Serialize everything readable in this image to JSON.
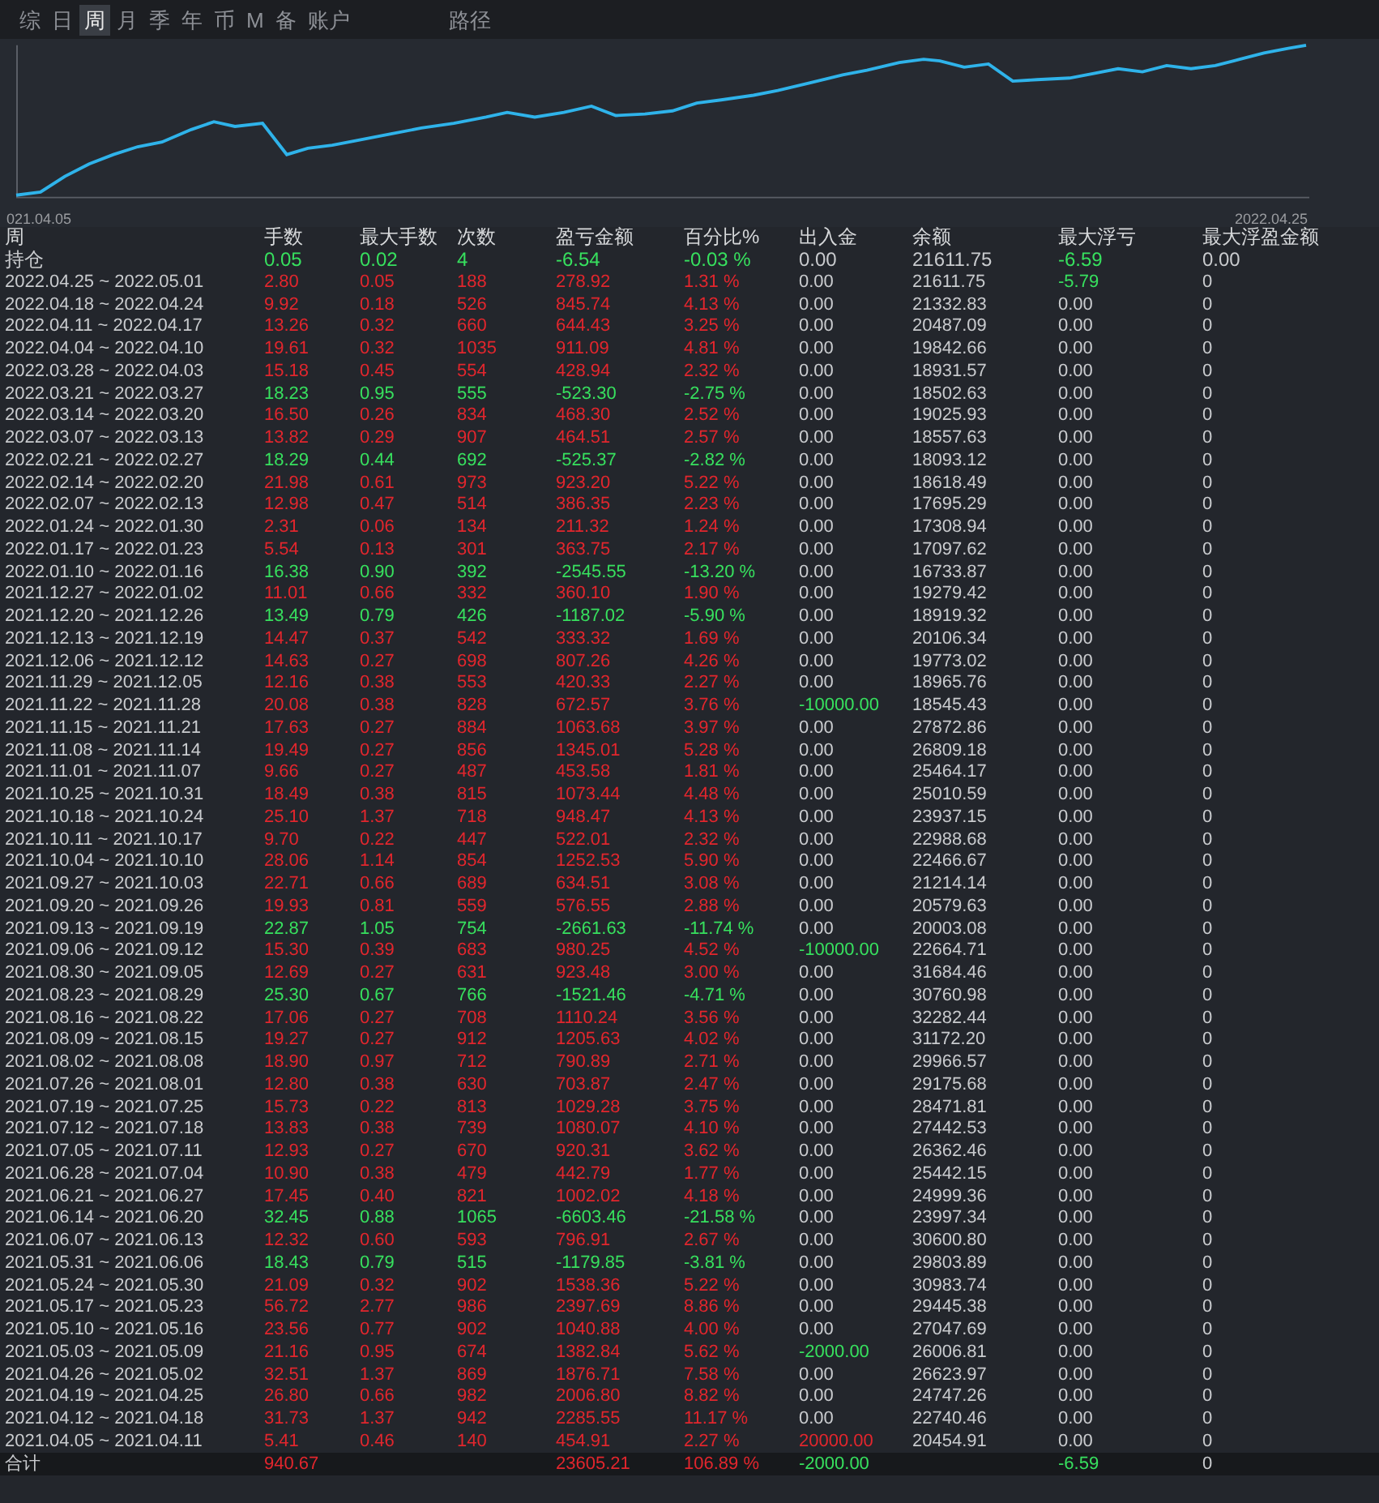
{
  "tabs": [
    {
      "label": "综",
      "selected": false
    },
    {
      "label": "日",
      "selected": false
    },
    {
      "label": "周",
      "selected": true
    },
    {
      "label": "月",
      "selected": false
    },
    {
      "label": "季",
      "selected": false
    },
    {
      "label": "年",
      "selected": false
    },
    {
      "label": "币",
      "selected": false
    },
    {
      "label": "M",
      "selected": false
    },
    {
      "label": "备",
      "selected": false
    },
    {
      "label": "账户",
      "selected": false
    }
  ],
  "path_tab": "路径",
  "chart": {
    "start_label": "021.04.05",
    "end_label": "2022.04.25"
  },
  "columns": [
    "周",
    "手数",
    "最大手数",
    "次数",
    "盈亏金额",
    "百分比%",
    "出入金",
    "余额",
    "最大浮亏",
    "最大浮盈金额"
  ],
  "holding": {
    "period": "持仓",
    "color": "#37e05e",
    "lots": "0.05",
    "max_lots": "0.02",
    "trades": "4",
    "pnl": "-6.54",
    "pct": "-0.03 %",
    "flow": "0.00",
    "balance": "21611.75",
    "max_float_loss": {
      "value": "-6.59",
      "color": "#37e05e"
    },
    "max_float_profit": "0.00"
  },
  "rows": [
    {
      "period": "2022.04.25 ~ 2022.05.01",
      "color": "#e2262d",
      "lots": "2.80",
      "max_lots": "0.05",
      "trades": "188",
      "pnl": "278.92",
      "pct": "1.31 %",
      "flow": "0.00",
      "balance": "21611.75",
      "max_float_loss": {
        "value": "-5.79",
        "color": "#37e05e"
      },
      "max_float_profit": "0"
    },
    {
      "period": "2022.04.18 ~ 2022.04.24",
      "color": "#e2262d",
      "lots": "9.92",
      "max_lots": "0.18",
      "trades": "526",
      "pnl": "845.74",
      "pct": "4.13 %",
      "flow": "0.00",
      "balance": "21332.83",
      "max_float_loss": "0.00",
      "max_float_profit": "0"
    },
    {
      "period": "2022.04.11 ~ 2022.04.17",
      "color": "#e2262d",
      "lots": "13.26",
      "max_lots": "0.32",
      "trades": "660",
      "pnl": "644.43",
      "pct": "3.25 %",
      "flow": "0.00",
      "balance": "20487.09",
      "max_float_loss": "0.00",
      "max_float_profit": "0"
    },
    {
      "period": "2022.04.04 ~ 2022.04.10",
      "color": "#e2262d",
      "lots": "19.61",
      "max_lots": "0.32",
      "trades": "1035",
      "pnl": "911.09",
      "pct": "4.81 %",
      "flow": "0.00",
      "balance": "19842.66",
      "max_float_loss": "0.00",
      "max_float_profit": "0"
    },
    {
      "period": "2022.03.28 ~ 2022.04.03",
      "color": "#e2262d",
      "lots": "15.18",
      "max_lots": "0.45",
      "trades": "554",
      "pnl": "428.94",
      "pct": "2.32 %",
      "flow": "0.00",
      "balance": "18931.57",
      "max_float_loss": "0.00",
      "max_float_profit": "0"
    },
    {
      "period": "2022.03.21 ~ 2022.03.27",
      "color": "#37e05e",
      "lots": "18.23",
      "max_lots": "0.95",
      "trades": "555",
      "pnl": "-523.30",
      "pct": "-2.75 %",
      "flow": "0.00",
      "balance": "18502.63",
      "max_float_loss": "0.00",
      "max_float_profit": "0"
    },
    {
      "period": "2022.03.14 ~ 2022.03.20",
      "color": "#e2262d",
      "lots": "16.50",
      "max_lots": "0.26",
      "trades": "834",
      "pnl": "468.30",
      "pct": "2.52 %",
      "flow": "0.00",
      "balance": "19025.93",
      "max_float_loss": "0.00",
      "max_float_profit": "0"
    },
    {
      "period": "2022.03.07 ~ 2022.03.13",
      "color": "#e2262d",
      "lots": "13.82",
      "max_lots": "0.29",
      "trades": "907",
      "pnl": "464.51",
      "pct": "2.57 %",
      "flow": "0.00",
      "balance": "18557.63",
      "max_float_loss": "0.00",
      "max_float_profit": "0"
    },
    {
      "period": "2022.02.21 ~ 2022.02.27",
      "color": "#37e05e",
      "lots": "18.29",
      "max_lots": "0.44",
      "trades": "692",
      "pnl": "-525.37",
      "pct": "-2.82 %",
      "flow": "0.00",
      "balance": "18093.12",
      "max_float_loss": "0.00",
      "max_float_profit": "0"
    },
    {
      "period": "2022.02.14 ~ 2022.02.20",
      "color": "#e2262d",
      "lots": "21.98",
      "max_lots": "0.61",
      "trades": "973",
      "pnl": "923.20",
      "pct": "5.22 %",
      "flow": "0.00",
      "balance": "18618.49",
      "max_float_loss": "0.00",
      "max_float_profit": "0"
    },
    {
      "period": "2022.02.07 ~ 2022.02.13",
      "color": "#e2262d",
      "lots": "12.98",
      "max_lots": "0.47",
      "trades": "514",
      "pnl": "386.35",
      "pct": "2.23 %",
      "flow": "0.00",
      "balance": "17695.29",
      "max_float_loss": "0.00",
      "max_float_profit": "0"
    },
    {
      "period": "2022.01.24 ~ 2022.01.30",
      "color": "#e2262d",
      "lots": "2.31",
      "max_lots": "0.06",
      "trades": "134",
      "pnl": "211.32",
      "pct": "1.24 %",
      "flow": "0.00",
      "balance": "17308.94",
      "max_float_loss": "0.00",
      "max_float_profit": "0"
    },
    {
      "period": "2022.01.17 ~ 2022.01.23",
      "color": "#e2262d",
      "lots": "5.54",
      "max_lots": "0.13",
      "trades": "301",
      "pnl": "363.75",
      "pct": "2.17 %",
      "flow": "0.00",
      "balance": "17097.62",
      "max_float_loss": "0.00",
      "max_float_profit": "0"
    },
    {
      "period": "2022.01.10 ~ 2022.01.16",
      "color": "#37e05e",
      "lots": "16.38",
      "max_lots": "0.90",
      "trades": "392",
      "pnl": "-2545.55",
      "pct": "-13.20 %",
      "flow": "0.00",
      "balance": "16733.87",
      "max_float_loss": "0.00",
      "max_float_profit": "0"
    },
    {
      "period": "2021.12.27 ~ 2022.01.02",
      "color": "#e2262d",
      "lots": "11.01",
      "max_lots": "0.66",
      "trades": "332",
      "pnl": "360.10",
      "pct": "1.90 %",
      "flow": "0.00",
      "balance": "19279.42",
      "max_float_loss": "0.00",
      "max_float_profit": "0"
    },
    {
      "period": "2021.12.20 ~ 2021.12.26",
      "color": "#37e05e",
      "lots": "13.49",
      "max_lots": "0.79",
      "trades": "426",
      "pnl": "-1187.02",
      "pct": "-5.90 %",
      "flow": "0.00",
      "balance": "18919.32",
      "max_float_loss": "0.00",
      "max_float_profit": "0"
    },
    {
      "period": "2021.12.13 ~ 2021.12.19",
      "color": "#e2262d",
      "lots": "14.47",
      "max_lots": "0.37",
      "trades": "542",
      "pnl": "333.32",
      "pct": "1.69 %",
      "flow": "0.00",
      "balance": "20106.34",
      "max_float_loss": "0.00",
      "max_float_profit": "0"
    },
    {
      "period": "2021.12.06 ~ 2021.12.12",
      "color": "#e2262d",
      "lots": "14.63",
      "max_lots": "0.27",
      "trades": "698",
      "pnl": "807.26",
      "pct": "4.26 %",
      "flow": "0.00",
      "balance": "19773.02",
      "max_float_loss": "0.00",
      "max_float_profit": "0"
    },
    {
      "period": "2021.11.29 ~ 2021.12.05",
      "color": "#e2262d",
      "lots": "12.16",
      "max_lots": "0.38",
      "trades": "553",
      "pnl": "420.33",
      "pct": "2.27 %",
      "flow": "0.00",
      "balance": "18965.76",
      "max_float_loss": "0.00",
      "max_float_profit": "0"
    },
    {
      "period": "2021.11.22 ~ 2021.11.28",
      "color": "#e2262d",
      "lots": "20.08",
      "max_lots": "0.38",
      "trades": "828",
      "pnl": "672.57",
      "pct": "3.76 %",
      "flow": {
        "value": "-10000.00",
        "color": "#37e05e"
      },
      "balance": "18545.43",
      "max_float_loss": "0.00",
      "max_float_profit": "0"
    },
    {
      "period": "2021.11.15 ~ 2021.11.21",
      "color": "#e2262d",
      "lots": "17.63",
      "max_lots": "0.27",
      "trades": "884",
      "pnl": "1063.68",
      "pct": "3.97 %",
      "flow": "0.00",
      "balance": "27872.86",
      "max_float_loss": "0.00",
      "max_float_profit": "0"
    },
    {
      "period": "2021.11.08 ~ 2021.11.14",
      "color": "#e2262d",
      "lots": "19.49",
      "max_lots": "0.27",
      "trades": "856",
      "pnl": "1345.01",
      "pct": "5.28 %",
      "flow": "0.00",
      "balance": "26809.18",
      "max_float_loss": "0.00",
      "max_float_profit": "0"
    },
    {
      "period": "2021.11.01 ~ 2021.11.07",
      "color": "#e2262d",
      "lots": "9.66",
      "max_lots": "0.27",
      "trades": "487",
      "pnl": "453.58",
      "pct": "1.81 %",
      "flow": "0.00",
      "balance": "25464.17",
      "max_float_loss": "0.00",
      "max_float_profit": "0"
    },
    {
      "period": "2021.10.25 ~ 2021.10.31",
      "color": "#e2262d",
      "lots": "18.49",
      "max_lots": "0.38",
      "trades": "815",
      "pnl": "1073.44",
      "pct": "4.48 %",
      "flow": "0.00",
      "balance": "25010.59",
      "max_float_loss": "0.00",
      "max_float_profit": "0"
    },
    {
      "period": "2021.10.18 ~ 2021.10.24",
      "color": "#e2262d",
      "lots": "25.10",
      "max_lots": "1.37",
      "trades": "718",
      "pnl": "948.47",
      "pct": "4.13 %",
      "flow": "0.00",
      "balance": "23937.15",
      "max_float_loss": "0.00",
      "max_float_profit": "0"
    },
    {
      "period": "2021.10.11 ~ 2021.10.17",
      "color": "#e2262d",
      "lots": "9.70",
      "max_lots": "0.22",
      "trades": "447",
      "pnl": "522.01",
      "pct": "2.32 %",
      "flow": "0.00",
      "balance": "22988.68",
      "max_float_loss": "0.00",
      "max_float_profit": "0"
    },
    {
      "period": "2021.10.04 ~ 2021.10.10",
      "color": "#e2262d",
      "lots": "28.06",
      "max_lots": "1.14",
      "trades": "854",
      "pnl": "1252.53",
      "pct": "5.90 %",
      "flow": "0.00",
      "balance": "22466.67",
      "max_float_loss": "0.00",
      "max_float_profit": "0"
    },
    {
      "period": "2021.09.27 ~ 2021.10.03",
      "color": "#e2262d",
      "lots": "22.71",
      "max_lots": "0.66",
      "trades": "689",
      "pnl": "634.51",
      "pct": "3.08 %",
      "flow": "0.00",
      "balance": "21214.14",
      "max_float_loss": "0.00",
      "max_float_profit": "0"
    },
    {
      "period": "2021.09.20 ~ 2021.09.26",
      "color": "#e2262d",
      "lots": "19.93",
      "max_lots": "0.81",
      "trades": "559",
      "pnl": "576.55",
      "pct": "2.88 %",
      "flow": "0.00",
      "balance": "20579.63",
      "max_float_loss": "0.00",
      "max_float_profit": "0"
    },
    {
      "period": "2021.09.13 ~ 2021.09.19",
      "color": "#37e05e",
      "lots": "22.87",
      "max_lots": "1.05",
      "trades": "754",
      "pnl": "-2661.63",
      "pct": "-11.74 %",
      "flow": "0.00",
      "balance": "20003.08",
      "max_float_loss": "0.00",
      "max_float_profit": "0"
    },
    {
      "period": "2021.09.06 ~ 2021.09.12",
      "color": "#e2262d",
      "lots": "15.30",
      "max_lots": "0.39",
      "trades": "683",
      "pnl": "980.25",
      "pct": "4.52 %",
      "flow": {
        "value": "-10000.00",
        "color": "#37e05e"
      },
      "balance": "22664.71",
      "max_float_loss": "0.00",
      "max_float_profit": "0"
    },
    {
      "period": "2021.08.30 ~ 2021.09.05",
      "color": "#e2262d",
      "lots": "12.69",
      "max_lots": "0.27",
      "trades": "631",
      "pnl": "923.48",
      "pct": "3.00 %",
      "flow": "0.00",
      "balance": "31684.46",
      "max_float_loss": "0.00",
      "max_float_profit": "0"
    },
    {
      "period": "2021.08.23 ~ 2021.08.29",
      "color": "#37e05e",
      "lots": "25.30",
      "max_lots": "0.67",
      "trades": "766",
      "pnl": "-1521.46",
      "pct": "-4.71 %",
      "flow": "0.00",
      "balance": "30760.98",
      "max_float_loss": "0.00",
      "max_float_profit": "0"
    },
    {
      "period": "2021.08.16 ~ 2021.08.22",
      "color": "#e2262d",
      "lots": "17.06",
      "max_lots": "0.27",
      "trades": "708",
      "pnl": "1110.24",
      "pct": "3.56 %",
      "flow": "0.00",
      "balance": "32282.44",
      "max_float_loss": "0.00",
      "max_float_profit": "0"
    },
    {
      "period": "2021.08.09 ~ 2021.08.15",
      "color": "#e2262d",
      "lots": "19.27",
      "max_lots": "0.27",
      "trades": "912",
      "pnl": "1205.63",
      "pct": "4.02 %",
      "flow": "0.00",
      "balance": "31172.20",
      "max_float_loss": "0.00",
      "max_float_profit": "0"
    },
    {
      "period": "2021.08.02 ~ 2021.08.08",
      "color": "#e2262d",
      "lots": "18.90",
      "max_lots": "0.97",
      "trades": "712",
      "pnl": "790.89",
      "pct": "2.71 %",
      "flow": "0.00",
      "balance": "29966.57",
      "max_float_loss": "0.00",
      "max_float_profit": "0"
    },
    {
      "period": "2021.07.26 ~ 2021.08.01",
      "color": "#e2262d",
      "lots": "12.80",
      "max_lots": "0.38",
      "trades": "630",
      "pnl": "703.87",
      "pct": "2.47 %",
      "flow": "0.00",
      "balance": "29175.68",
      "max_float_loss": "0.00",
      "max_float_profit": "0"
    },
    {
      "period": "2021.07.19 ~ 2021.07.25",
      "color": "#e2262d",
      "lots": "15.73",
      "max_lots": "0.22",
      "trades": "813",
      "pnl": "1029.28",
      "pct": "3.75 %",
      "flow": "0.00",
      "balance": "28471.81",
      "max_float_loss": "0.00",
      "max_float_profit": "0"
    },
    {
      "period": "2021.07.12 ~ 2021.07.18",
      "color": "#e2262d",
      "lots": "13.83",
      "max_lots": "0.38",
      "trades": "739",
      "pnl": "1080.07",
      "pct": "4.10 %",
      "flow": "0.00",
      "balance": "27442.53",
      "max_float_loss": "0.00",
      "max_float_profit": "0"
    },
    {
      "period": "2021.07.05 ~ 2021.07.11",
      "color": "#e2262d",
      "lots": "12.93",
      "max_lots": "0.27",
      "trades": "670",
      "pnl": "920.31",
      "pct": "3.62 %",
      "flow": "0.00",
      "balance": "26362.46",
      "max_float_loss": "0.00",
      "max_float_profit": "0"
    },
    {
      "period": "2021.06.28 ~ 2021.07.04",
      "color": "#e2262d",
      "lots": "10.90",
      "max_lots": "0.38",
      "trades": "479",
      "pnl": "442.79",
      "pct": "1.77 %",
      "flow": "0.00",
      "balance": "25442.15",
      "max_float_loss": "0.00",
      "max_float_profit": "0"
    },
    {
      "period": "2021.06.21 ~ 2021.06.27",
      "color": "#e2262d",
      "lots": "17.45",
      "max_lots": "0.40",
      "trades": "821",
      "pnl": "1002.02",
      "pct": "4.18 %",
      "flow": "0.00",
      "balance": "24999.36",
      "max_float_loss": "0.00",
      "max_float_profit": "0"
    },
    {
      "period": "2021.06.14 ~ 2021.06.20",
      "color": "#37e05e",
      "lots": "32.45",
      "max_lots": "0.88",
      "trades": "1065",
      "pnl": "-6603.46",
      "pct": "-21.58 %",
      "flow": "0.00",
      "balance": "23997.34",
      "max_float_loss": "0.00",
      "max_float_profit": "0"
    },
    {
      "period": "2021.06.07 ~ 2021.06.13",
      "color": "#e2262d",
      "lots": "12.32",
      "max_lots": "0.60",
      "trades": "593",
      "pnl": "796.91",
      "pct": "2.67 %",
      "flow": "0.00",
      "balance": "30600.80",
      "max_float_loss": "0.00",
      "max_float_profit": "0"
    },
    {
      "period": "2021.05.31 ~ 2021.06.06",
      "color": "#37e05e",
      "lots": "18.43",
      "max_lots": "0.79",
      "trades": "515",
      "pnl": "-1179.85",
      "pct": "-3.81 %",
      "flow": "0.00",
      "balance": "29803.89",
      "max_float_loss": "0.00",
      "max_float_profit": "0"
    },
    {
      "period": "2021.05.24 ~ 2021.05.30",
      "color": "#e2262d",
      "lots": "21.09",
      "max_lots": "0.32",
      "trades": "902",
      "pnl": "1538.36",
      "pct": "5.22 %",
      "flow": "0.00",
      "balance": "30983.74",
      "max_float_loss": "0.00",
      "max_float_profit": "0"
    },
    {
      "period": "2021.05.17 ~ 2021.05.23",
      "color": "#e2262d",
      "lots": "56.72",
      "max_lots": "2.77",
      "trades": "986",
      "pnl": "2397.69",
      "pct": "8.86 %",
      "flow": "0.00",
      "balance": "29445.38",
      "max_float_loss": "0.00",
      "max_float_profit": "0"
    },
    {
      "period": "2021.05.10 ~ 2021.05.16",
      "color": "#e2262d",
      "lots": "23.56",
      "max_lots": "0.77",
      "trades": "902",
      "pnl": "1040.88",
      "pct": "4.00 %",
      "flow": "0.00",
      "balance": "27047.69",
      "max_float_loss": "0.00",
      "max_float_profit": "0"
    },
    {
      "period": "2021.05.03 ~ 2021.05.09",
      "color": "#e2262d",
      "lots": "21.16",
      "max_lots": "0.95",
      "trades": "674",
      "pnl": "1382.84",
      "pct": "5.62 %",
      "flow": {
        "value": "-2000.00",
        "color": "#37e05e"
      },
      "balance": "26006.81",
      "max_float_loss": "0.00",
      "max_float_profit": "0"
    },
    {
      "period": "2021.04.26 ~ 2021.05.02",
      "color": "#e2262d",
      "lots": "32.51",
      "max_lots": "1.37",
      "trades": "869",
      "pnl": "1876.71",
      "pct": "7.58 %",
      "flow": "0.00",
      "balance": "26623.97",
      "max_float_loss": "0.00",
      "max_float_profit": "0"
    },
    {
      "period": "2021.04.19 ~ 2021.04.25",
      "color": "#e2262d",
      "lots": "26.80",
      "max_lots": "0.66",
      "trades": "982",
      "pnl": "2006.80",
      "pct": "8.82 %",
      "flow": "0.00",
      "balance": "24747.26",
      "max_float_loss": "0.00",
      "max_float_profit": "0"
    },
    {
      "period": "2021.04.12 ~ 2021.04.18",
      "color": "#e2262d",
      "lots": "31.73",
      "max_lots": "1.37",
      "trades": "942",
      "pnl": "2285.55",
      "pct": "11.17 %",
      "flow": "0.00",
      "balance": "22740.46",
      "max_float_loss": "0.00",
      "max_float_profit": "0"
    },
    {
      "period": "2021.04.05 ~ 2021.04.11",
      "color": "#e2262d",
      "lots": "5.41",
      "max_lots": "0.46",
      "trades": "140",
      "pnl": "454.91",
      "pct": "2.27 %",
      "flow": {
        "value": "20000.00",
        "color": "#e2262d"
      },
      "balance": "20454.91",
      "max_float_loss": "0.00",
      "max_float_profit": "0"
    }
  ],
  "total": {
    "period": "合计",
    "color": "#e2262d",
    "lots": "940.67",
    "pnl": "23605.21",
    "pct": "106.89 %",
    "flow": {
      "value": "-2000.00",
      "color": "#37e05e"
    },
    "max_float_loss": {
      "value": "-6.59",
      "color": "#37e05e"
    },
    "max_float_profit": "0"
  }
}
